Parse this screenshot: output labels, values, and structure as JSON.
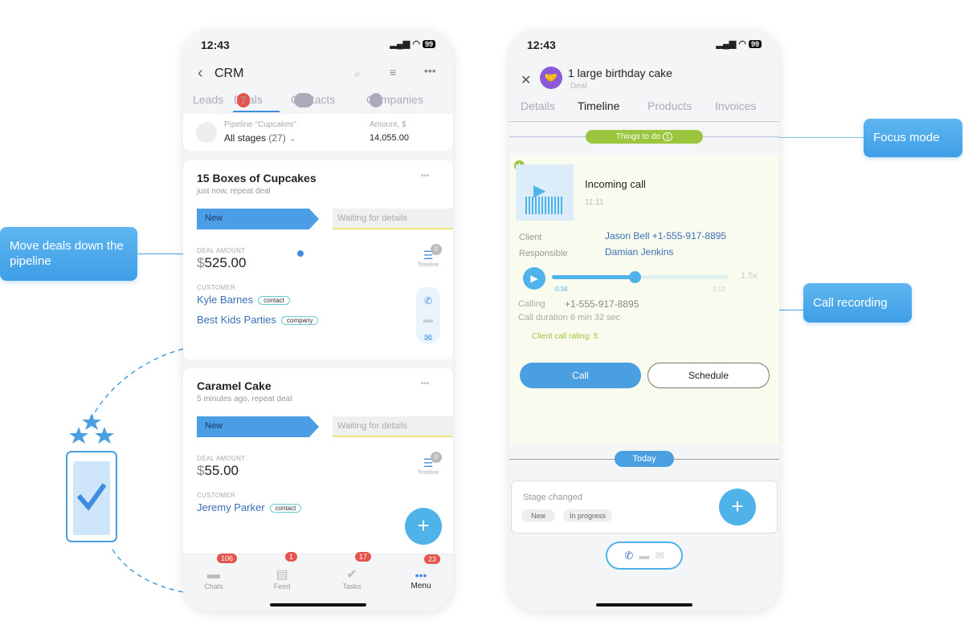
{
  "callouts": {
    "move_deals": "Move deals down the pipeline",
    "focus_mode": "Focus mode",
    "call_recording": "Call recording"
  },
  "left_phone": {
    "status": {
      "time": "12:43",
      "battery": "99"
    },
    "header": {
      "title": "CRM"
    },
    "tabs": [
      {
        "label": "Leads"
      },
      {
        "label": "Deals",
        "count": "7"
      },
      {
        "label": "Contacts",
        "count": "14"
      },
      {
        "label": "Companies",
        "count": "2"
      }
    ],
    "pipeline": {
      "label": "Pipeline \"Cupcakes\"",
      "stages": "All stages",
      "stages_count": "(27)",
      "amount_label": "Amount, $",
      "amount": "14,055.00"
    },
    "deals": [
      {
        "title": "15 Boxes of Cupcakes",
        "subtitle": "just now, repeat deal",
        "stage": "New",
        "next_stage": "Waiting for details",
        "amount_label": "DEAL AMOUNT",
        "currency": "$",
        "amount": "525.00",
        "customer_label": "CUSTOMER",
        "contact": "Kyle Barnes",
        "contact_tag": "contact",
        "company": "Best Kids Parties",
        "company_tag": "company",
        "timeline_label": "Timeline",
        "timeline_count": "0"
      },
      {
        "title": "Caramel Cake",
        "subtitle": "5 minutes ago, repeat deal",
        "stage": "New",
        "next_stage": "Waiting for details",
        "amount_label": "DEAL AMOUNT",
        "currency": "$",
        "amount": "55.00",
        "customer_label": "CUSTOMER",
        "contact": "Jeremy Parker",
        "contact_tag": "contact",
        "timeline_label": "Timeline",
        "timeline_count": "0"
      }
    ],
    "fab": "+",
    "nav": [
      {
        "label": "Chats",
        "badge": "106"
      },
      {
        "label": "Feed",
        "badge": "1"
      },
      {
        "label": "Tasks",
        "badge": "17"
      },
      {
        "label": "Menu",
        "badge": "23"
      }
    ]
  },
  "right_phone": {
    "status": {
      "time": "12:43",
      "battery": "99"
    },
    "header": {
      "title": "1 large birthday cake",
      "subtitle": "Deal"
    },
    "tabs": [
      {
        "label": "Details"
      },
      {
        "label": "Timeline"
      },
      {
        "label": "Products"
      },
      {
        "label": "Invoices"
      }
    ],
    "things_to_do": {
      "label": "Things to do",
      "count": "1"
    },
    "activity": {
      "index": "1",
      "title": "Incoming call",
      "time": "11:11",
      "client_label": "Client",
      "client": "Jason Bell +1-555-917-8895",
      "responsible_label": "Responsible",
      "responsible": "Damian Jenkins",
      "elapsed": "0:34",
      "total": "1:12",
      "progress": 0.47,
      "speed": "1.5x",
      "calling_label": "Calling",
      "calling": "+1-555-917-8895",
      "duration": "Call duration 6 min 32 sec",
      "rating": "Client call rating: 5",
      "call_button": "Call",
      "schedule_button": "Schedule"
    },
    "today": "Today",
    "stage_changed": {
      "title": "Stage changed",
      "from": "New",
      "to": "In progress"
    },
    "fab": "+"
  },
  "colors": {
    "accent": "#4fb3ea",
    "green": "#9bc53d",
    "badge_red": "#e5534b",
    "link": "#3b6fb6"
  }
}
